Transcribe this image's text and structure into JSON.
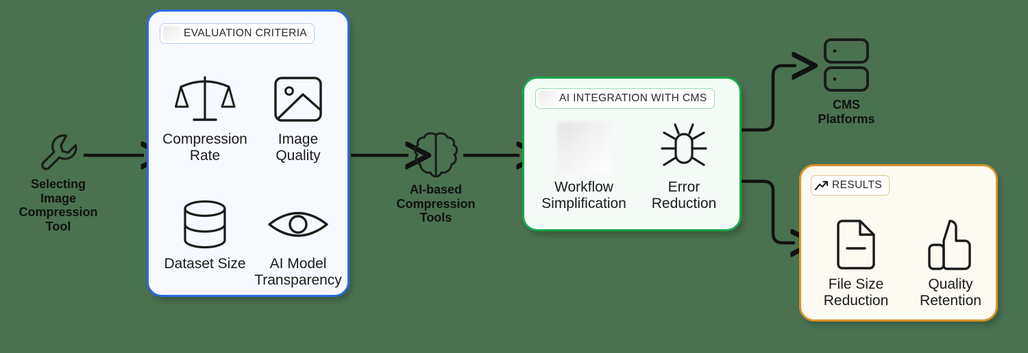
{
  "theme": {
    "background": "#4a7150",
    "blue": "#2b6bdd",
    "green": "#19a84a",
    "orange": "#d8932a",
    "panel_blue_fill": "#f6f9ff",
    "panel_green_fill": "#f4fbf6",
    "panel_orange_fill": "#fdfaf1",
    "stroke": "#1b1b1b"
  },
  "start_node": {
    "icon": "wrench-icon",
    "label": "Selecting\nImage\nCompression\nTool"
  },
  "evaluation_panel": {
    "chip_label": "EVALUATION CRITERIA",
    "chip_icon": "blurred-placeholder-icon",
    "accent": "#2b6bdd",
    "items": [
      {
        "icon": "balance-scale-icon",
        "label": "Compression\nRate"
      },
      {
        "icon": "image-icon",
        "label": "Image\nQuality"
      },
      {
        "icon": "database-icon",
        "label": "Dataset Size"
      },
      {
        "icon": "eye-icon",
        "label": "AI Model\nTransparency"
      }
    ]
  },
  "middle_node": {
    "icon": "brain-icon",
    "label": "AI-based\nCompression\nTools"
  },
  "cms_panel": {
    "chip_label": "AI INTEGRATION WITH CMS",
    "chip_icon": "blurred-placeholder-icon",
    "accent": "#19a84a",
    "items": [
      {
        "icon": "blurred-placeholder-icon",
        "label": "Workflow\nSimplification"
      },
      {
        "icon": "bug-icon",
        "label": "Error\nReduction"
      }
    ]
  },
  "cms_platforms_node": {
    "icon": "server-stack-icon",
    "label": "CMS\nPlatforms"
  },
  "results_panel": {
    "chip_label": "RESULTS",
    "chip_icon": "trending-up-icon",
    "accent": "#d8932a",
    "items": [
      {
        "icon": "file-minus-icon",
        "label": "File Size\nReduction"
      },
      {
        "icon": "thumbs-up-icon",
        "label": "Quality\nRetention"
      }
    ]
  },
  "connectors": [
    {
      "name": "start-to-evaluation",
      "type": "straight-arrow"
    },
    {
      "name": "evaluation-to-brain",
      "type": "straight-arrow"
    },
    {
      "name": "brain-to-cms",
      "type": "straight-arrow"
    },
    {
      "name": "cms-to-platforms",
      "type": "elbow-arrow-up"
    },
    {
      "name": "cms-to-results",
      "type": "elbow-arrow-down"
    }
  ]
}
